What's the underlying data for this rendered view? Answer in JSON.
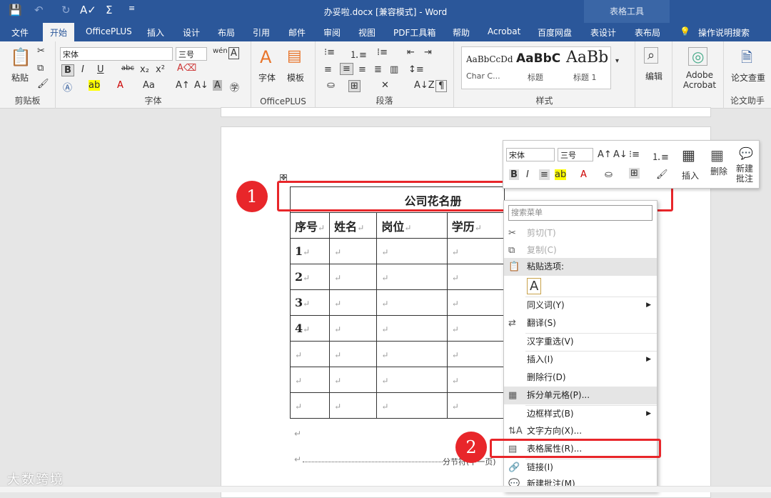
{
  "titlebar": {
    "title": "办妥啦.docx [兼容模式] - Word",
    "context_tab": "表格工具"
  },
  "tabs": [
    "文件",
    "开始",
    "OfficePLUS",
    "插入",
    "设计",
    "布局",
    "引用",
    "邮件",
    "审阅",
    "视图",
    "PDF工具箱",
    "帮助",
    "Acrobat",
    "百度网盘",
    "表设计",
    "表布局",
    "操作说明搜索"
  ],
  "ribbon": {
    "font_name": "宋体",
    "font_size": "三号",
    "groups": {
      "clipboard": "剪贴板",
      "font": "字体",
      "officeplus": "OfficePLUS",
      "paragraph": "段落",
      "styles": "样式",
      "editing": "编辑",
      "adobe": "Adobe Acrobat",
      "paper": "论文查重",
      "paper_help": "论文助手"
    },
    "paste": "粘贴",
    "font_btn": "字体",
    "template_btn": "模板",
    "styles": [
      {
        "preview": "AaBbCcDd",
        "name": "Char C..."
      },
      {
        "preview": "AaBbC",
        "name": "标题"
      },
      {
        "preview": "AaBb",
        "name": "标题 1"
      }
    ],
    "edit_btn": "编辑"
  },
  "document": {
    "title": "公司花名册",
    "headers": [
      "序号",
      "姓名",
      "岗位",
      "学历"
    ],
    "rows": [
      [
        "1",
        "",
        "",
        ""
      ],
      [
        "2",
        "",
        "",
        ""
      ],
      [
        "3",
        "",
        "",
        ""
      ],
      [
        "4",
        "",
        "",
        ""
      ],
      [
        "",
        "",
        "",
        ""
      ],
      [
        "",
        "",
        "",
        ""
      ],
      [
        "",
        "",
        "",
        ""
      ]
    ],
    "section_break": "分节符(下一页)"
  },
  "mini_toolbar": {
    "font": "宋体",
    "size": "三号",
    "insert": "插入",
    "delete": "删除",
    "new_comment": "新建批注"
  },
  "context_menu": {
    "search_placeholder": "搜索菜单",
    "items": [
      "剪切(T)",
      "复制(C)",
      "粘贴选项:",
      "同义词(Y)",
      "翻译(S)",
      "汉字重选(V)",
      "插入(I)",
      "删除行(D)",
      "拆分单元格(P)...",
      "边框样式(B)",
      "文字方向(X)...",
      "表格属性(R)...",
      "链接(I)",
      "新建批注(M)"
    ]
  },
  "callouts": [
    "1",
    "2"
  ],
  "watermark": "大数跨境"
}
